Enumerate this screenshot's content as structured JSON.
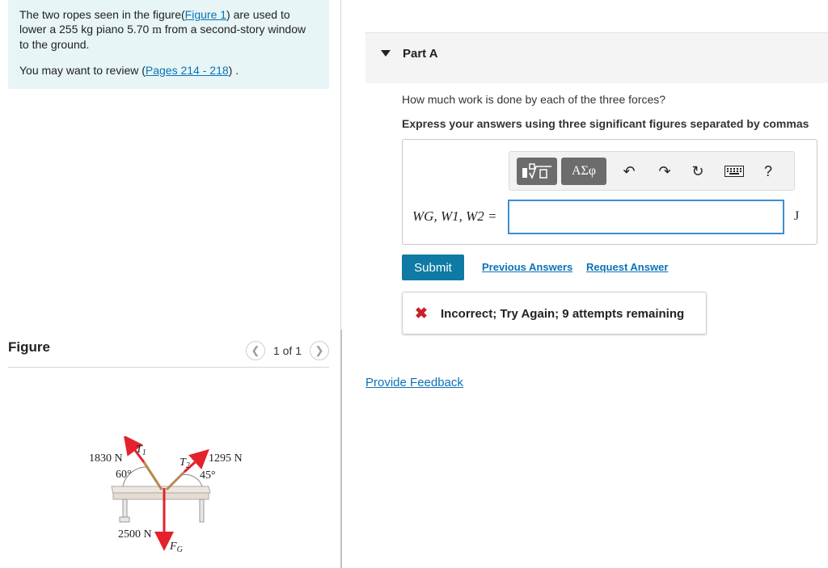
{
  "problem": {
    "text_before_link": "The two ropes seen in the figure(",
    "figure_link": "Figure 1",
    "text_after_link": ") are used to lower a 255 kg piano 5.70 ",
    "unit_m": "m",
    "text_end": " from a second-story window to the ground.",
    "review_prefix": "You may want to review (",
    "review_link": "Pages 214 - 218",
    "review_suffix": ") ."
  },
  "figure": {
    "title": "Figure",
    "pager_text": "1 of 1",
    "prev_icon": "chevron-left-icon",
    "next_icon": "chevron-right-icon",
    "labels": {
      "t1_force": "1830 N",
      "t1_angle": "60°",
      "t1_name": "T",
      "t1_sub": "1",
      "t2_force": "1295 N",
      "t2_angle": "45°",
      "t2_name": "T",
      "t2_sub": "2",
      "g_force": "2500 N",
      "g_name": "F",
      "g_sub": "G"
    },
    "colors": {
      "t1_arrow": "#e3222b",
      "t2_arrow": "#e3222b",
      "g_arrow": "#e3222b",
      "rope": "#b88850",
      "piano": "#e4dcd2"
    }
  },
  "part": {
    "title": "Part A",
    "question": "How much work is done by each of the three forces?",
    "instruction": "Express your answers using three significant figures separated by commas",
    "toolbar": {
      "template_icon": "templates-icon",
      "greek_label": "ΑΣφ",
      "undo_icon": "undo-icon",
      "redo_icon": "redo-icon",
      "reset_icon": "reset-icon",
      "keyboard_icon": "keyboard-icon",
      "help_label": "?"
    },
    "equation_label": "WG, W1, W2 =",
    "input_value": "",
    "unit": "J",
    "submit_label": "Submit",
    "previous_answers": "Previous Answers",
    "request_answer": "Request Answer",
    "feedback": "Incorrect; Try Again; 9 attempts remaining",
    "feedback_icon": "x-icon"
  },
  "provide_feedback": "Provide Feedback"
}
